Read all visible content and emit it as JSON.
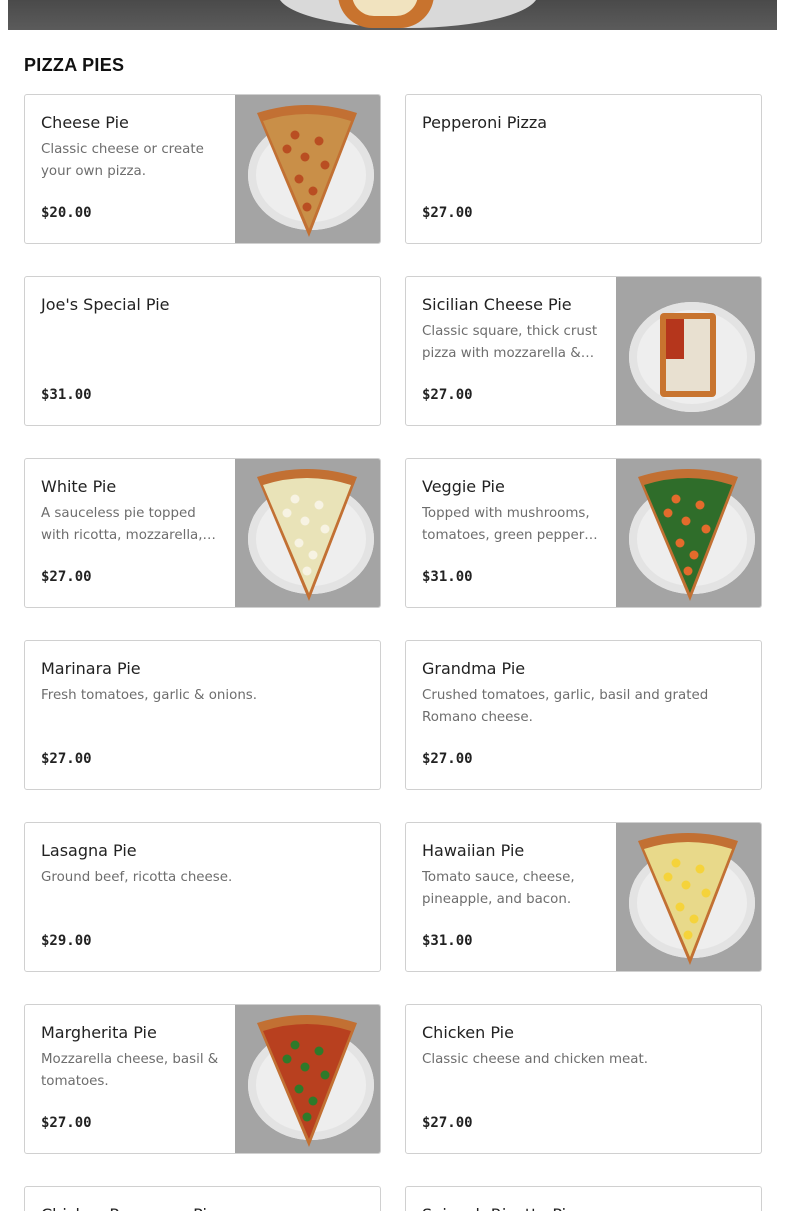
{
  "section": {
    "title": "PIZZA PIES"
  },
  "items": [
    {
      "name": "Cheese Pie",
      "description": "Classic cheese or create your own pizza.",
      "price": "$20.00",
      "image": "cheese-pizza-slice",
      "topping": "#c98f48"
    },
    {
      "name": "Pepperoni Pizza",
      "description": "",
      "price": "$27.00",
      "image": ""
    },
    {
      "name": "Joe's Special Pie",
      "description": "",
      "price": "$31.00",
      "image": ""
    },
    {
      "name": "Sicilian Cheese Pie",
      "description": "Classic square, thick crust pizza with mozzarella & sauce.",
      "price": "$27.00",
      "image": "sicilian-pizza-square",
      "topping": "#e8e0d0"
    },
    {
      "name": "White Pie",
      "description": "A sauceless pie topped with ricotta, mozzarella, and garlic.",
      "price": "$27.00",
      "image": "white-pizza-slice",
      "topping": "#e9e3b8"
    },
    {
      "name": "Veggie Pie",
      "description": "Topped with mushrooms, tomatoes, green peppers, onions and olives.",
      "price": "$31.00",
      "image": "veggie-pizza-slice",
      "topping": "#2f6d2a"
    },
    {
      "name": "Marinara Pie",
      "description": "Fresh tomatoes, garlic & onions.",
      "price": "$27.00",
      "image": ""
    },
    {
      "name": "Grandma Pie",
      "description": "Crushed tomatoes, garlic, basil and grated Romano cheese.",
      "price": "$27.00",
      "image": ""
    },
    {
      "name": "Lasagna Pie",
      "description": "Ground beef, ricotta cheese.",
      "price": "$29.00",
      "image": ""
    },
    {
      "name": "Hawaiian Pie",
      "description": "Tomato sauce, cheese, pineapple, and bacon.",
      "price": "$31.00",
      "image": "hawaiian-pizza-slice",
      "topping": "#e8d98a"
    },
    {
      "name": "Margherita Pie",
      "description": "Mozzarella cheese, basil & tomatoes.",
      "price": "$27.00",
      "image": "margherita-pizza-slice",
      "topping": "#b8401f"
    },
    {
      "name": "Chicken Pie",
      "description": "Classic cheese and chicken meat.",
      "price": "$27.00",
      "image": ""
    }
  ],
  "partial_items": [
    {
      "name": "Chicken Parmesan Pizza"
    },
    {
      "name": "Spinach Ricotta Pizza"
    }
  ]
}
